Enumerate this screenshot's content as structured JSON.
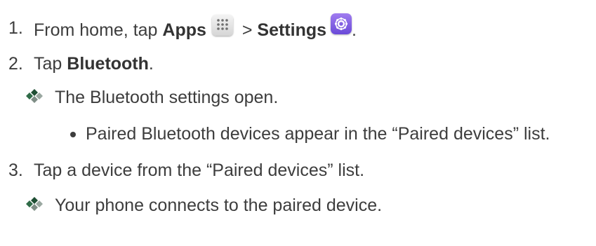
{
  "steps": [
    {
      "number": "1.",
      "prefix": "From home, tap ",
      "apps_label": "Apps",
      "separator": " > ",
      "settings_label": "Settings",
      "suffix": "."
    },
    {
      "number": "2.",
      "prefix": "Tap ",
      "bold": "Bluetooth",
      "suffix": "."
    },
    {
      "number": "3.",
      "text": "Tap a device from the “Paired devices” list."
    }
  ],
  "results": [
    "The Bluetooth settings open.",
    "Your phone connects to the paired device."
  ],
  "bullets": [
    "Paired Bluetooth devices appear in the “Paired devices” list."
  ],
  "icons": {
    "apps": "apps-grid-icon",
    "settings": "settings-gear-icon",
    "result_marker": "four-diamond-icon"
  },
  "colors": {
    "text": "#3d3d3d",
    "settings_icon": "#7b57e0",
    "diamond_dark": "#1e4e33",
    "diamond_light": "#9aa7a0"
  }
}
